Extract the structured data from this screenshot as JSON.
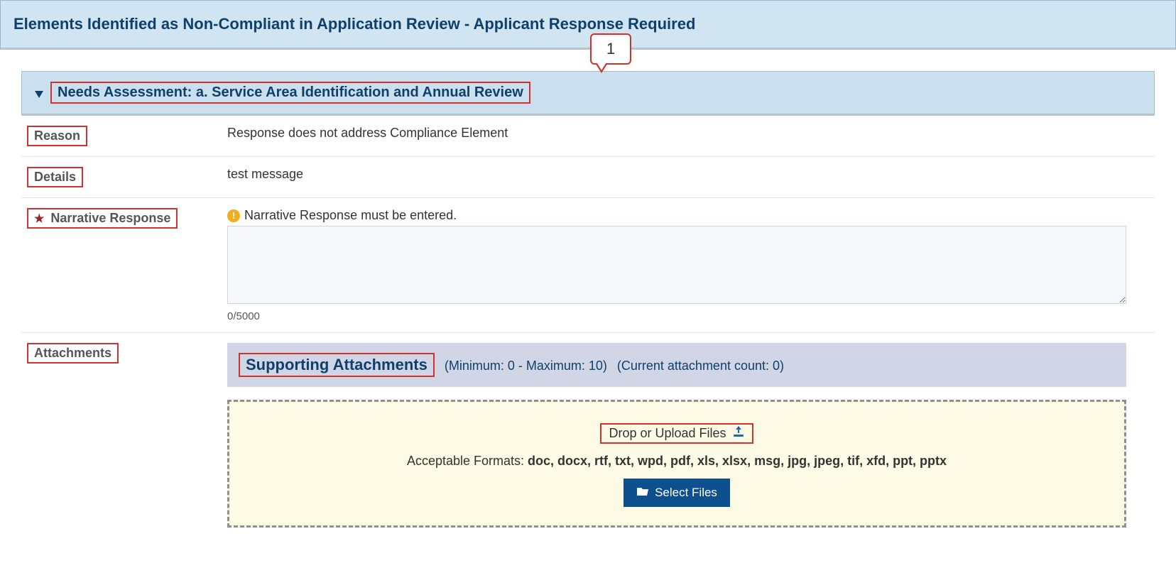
{
  "header": {
    "title": "Elements Identified as Non-Compliant in Application Review - Applicant Response Required"
  },
  "callout": {
    "number": "1"
  },
  "section": {
    "title": "Needs Assessment: a. Service Area Identification and Annual Review"
  },
  "fields": {
    "reason": {
      "label": "Reason",
      "value": "Response does not address Compliance Element"
    },
    "details": {
      "label": "Details",
      "value": "test message"
    },
    "narrative": {
      "label": "Narrative Response",
      "warning": "Narrative Response must be entered.",
      "value": "",
      "counter": "0/5000"
    },
    "attachments": {
      "label": "Attachments"
    }
  },
  "attachments_panel": {
    "title": "Supporting Attachments",
    "limits": "(Minimum: 0 - Maximum: 10)",
    "count": "(Current attachment count: 0)",
    "drop_label": "Drop or Upload Files",
    "formats_label": "Acceptable Formats: ",
    "formats_list": "doc, docx, rtf, txt, wpd, pdf, xls, xlsx, msg, jpg, jpeg, tif, xfd, ppt, pptx",
    "select_button": "Select Files"
  }
}
